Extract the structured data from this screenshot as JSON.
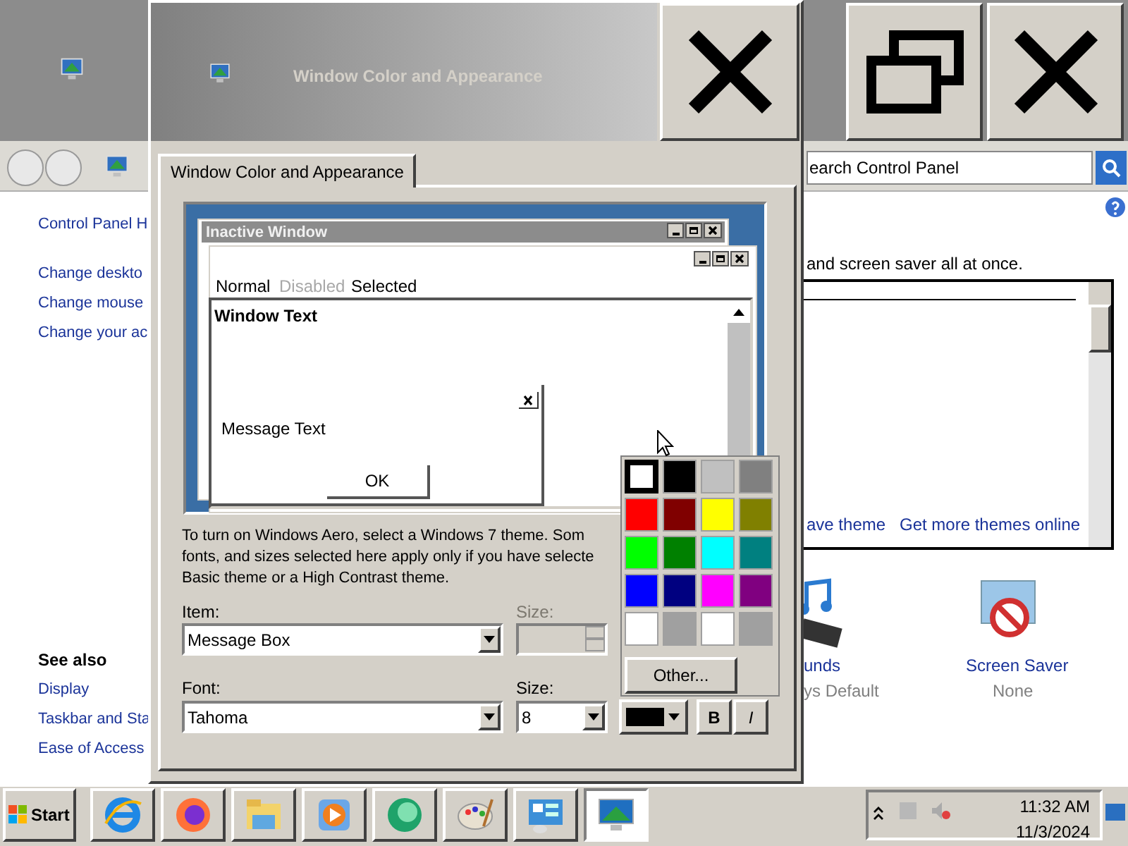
{
  "background_window": {
    "nav_links": [
      "Control Panel H",
      "Change deskto",
      "Change mouse",
      "Change your ac"
    ],
    "see_also": {
      "heading": "See also",
      "links": [
        "Display",
        "Taskbar and Sta",
        "Ease of Access"
      ]
    },
    "search": {
      "placeholder": "earch Control Panel"
    },
    "description": "and screen saver all at once.",
    "theme_links": [
      "ave theme",
      "Get more themes online"
    ],
    "items": [
      {
        "kind": "sounds",
        "label": "unds",
        "value": "ys Default"
      },
      {
        "kind": "screensaver",
        "label": "Screen Saver",
        "value": "None"
      }
    ]
  },
  "dialog": {
    "title": "Window Color and Appearance",
    "tabs": [
      {
        "label": "Window Color and Appearance",
        "selected": true
      }
    ],
    "preview": {
      "inactive_title": "Inactive Window",
      "menu": [
        {
          "label": "Normal",
          "disabled": false
        },
        {
          "label": "Disabled",
          "disabled": true
        },
        {
          "label": "Selected",
          "disabled": false
        }
      ],
      "window_text": "Window Text",
      "message_text": "Message Text",
      "ok": "OK"
    },
    "description_lines": [
      "To turn on Windows Aero, select a Windows 7 theme.  Som",
      "fonts, and sizes selected here apply only if you have selecte",
      "Basic theme or a High Contrast theme."
    ],
    "item": {
      "label": "Item:",
      "value": "Message Box"
    },
    "item_size": {
      "label": "Size:",
      "disabled": true
    },
    "font": {
      "label": "Font:",
      "value": "Tahoma"
    },
    "font_size": {
      "label": "Size:",
      "value": "8"
    },
    "font_color": {
      "color": "#000000"
    },
    "bold": {
      "label": "B",
      "on": false
    },
    "italic": {
      "label": "I",
      "on": false
    }
  },
  "color_popup": {
    "swatches": [
      {
        "color": "#ffffff",
        "selected": true
      },
      {
        "color": "#000000",
        "selected": false
      },
      {
        "color": "#c0c0c0",
        "selected": false
      },
      {
        "color": "#808080",
        "selected": false
      },
      {
        "color": "#ff0000",
        "selected": false
      },
      {
        "color": "#800000",
        "selected": false
      },
      {
        "color": "#ffff00",
        "selected": false
      },
      {
        "color": "#808000",
        "selected": false
      },
      {
        "color": "#00ff00",
        "selected": false
      },
      {
        "color": "#008000",
        "selected": false
      },
      {
        "color": "#00ffff",
        "selected": false
      },
      {
        "color": "#008080",
        "selected": false
      },
      {
        "color": "#0000ff",
        "selected": false
      },
      {
        "color": "#000080",
        "selected": false
      },
      {
        "color": "#ff00ff",
        "selected": false
      },
      {
        "color": "#800080",
        "selected": false
      },
      {
        "color": "#ffffff",
        "selected": false
      },
      {
        "color": "#a0a0a0",
        "selected": false
      },
      {
        "color": "#ffffff",
        "selected": false
      },
      {
        "color": "#a0a0a0",
        "selected": false
      }
    ],
    "other_button": "Other..."
  },
  "taskbar": {
    "start": "Start",
    "apps": [
      {
        "kind": "browser",
        "selected": false
      },
      {
        "kind": "firefox",
        "selected": false
      },
      {
        "kind": "folder",
        "selected": false
      },
      {
        "kind": "media",
        "selected": false
      },
      {
        "kind": "chat",
        "selected": false
      },
      {
        "kind": "paint",
        "selected": false
      },
      {
        "kind": "control",
        "selected": false
      },
      {
        "kind": "display",
        "selected": true
      }
    ],
    "clock": {
      "time": "11:32 AM",
      "date": "11/3/2024"
    }
  }
}
